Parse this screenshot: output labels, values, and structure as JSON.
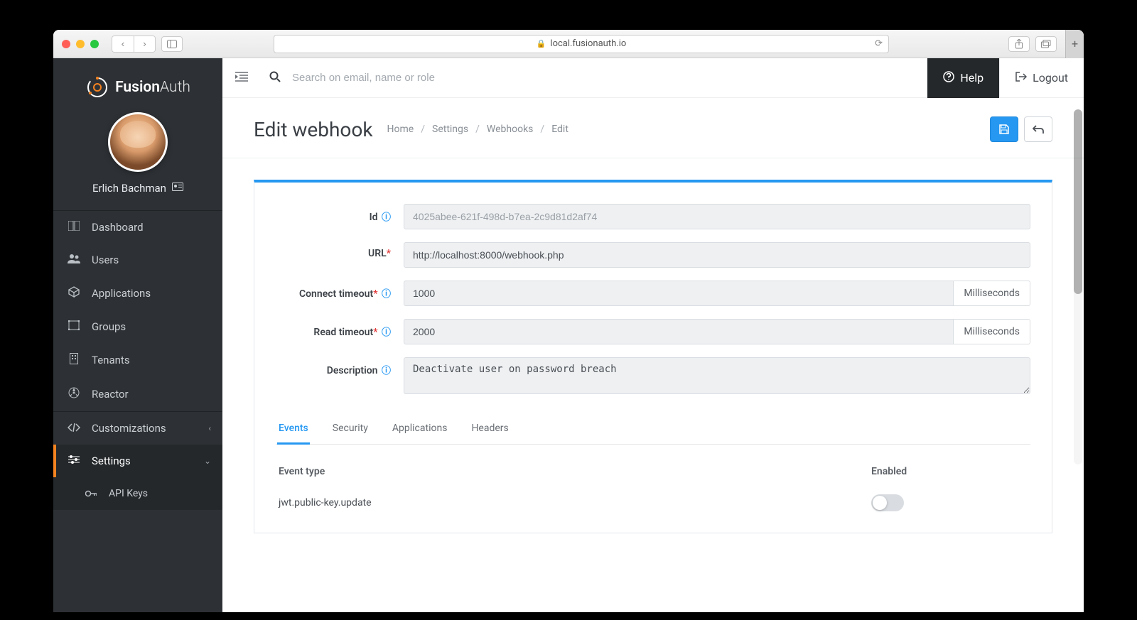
{
  "browser": {
    "url": "local.fusionauth.io"
  },
  "brand": {
    "name": "Fusion",
    "suffix": "Auth"
  },
  "user": {
    "name": "Erlich Bachman"
  },
  "sidebar": {
    "items": [
      {
        "icon": "dashboard",
        "label": "Dashboard"
      },
      {
        "icon": "users",
        "label": "Users"
      },
      {
        "icon": "applications",
        "label": "Applications"
      },
      {
        "icon": "groups",
        "label": "Groups"
      },
      {
        "icon": "tenants",
        "label": "Tenants"
      },
      {
        "icon": "reactor",
        "label": "Reactor"
      },
      {
        "icon": "customizations",
        "label": "Customizations",
        "expandable": true
      },
      {
        "icon": "settings",
        "label": "Settings",
        "active": true,
        "expanded": true
      },
      {
        "icon": "apikeys",
        "label": "API Keys",
        "sub": true
      }
    ]
  },
  "topbar": {
    "search_placeholder": "Search on email, name or role",
    "help": "Help",
    "logout": "Logout"
  },
  "page": {
    "title": "Edit webhook",
    "breadcrumb": [
      "Home",
      "Settings",
      "Webhooks",
      "Edit"
    ]
  },
  "form": {
    "labels": {
      "id": "Id",
      "url": "URL",
      "connect_timeout": "Connect timeout",
      "read_timeout": "Read timeout",
      "description": "Description",
      "unit": "Milliseconds"
    },
    "values": {
      "id": "4025abee-621f-498d-b7ea-2c9d81d2af74",
      "url": "http://localhost:8000/webhook.php",
      "connect_timeout": "1000",
      "read_timeout": "2000",
      "description": "Deactivate user on password breach"
    }
  },
  "tabs": [
    "Events",
    "Security",
    "Applications",
    "Headers"
  ],
  "events": {
    "header_type": "Event type",
    "header_enabled": "Enabled",
    "rows": [
      {
        "type": "jwt.public-key.update",
        "enabled": false
      }
    ]
  }
}
